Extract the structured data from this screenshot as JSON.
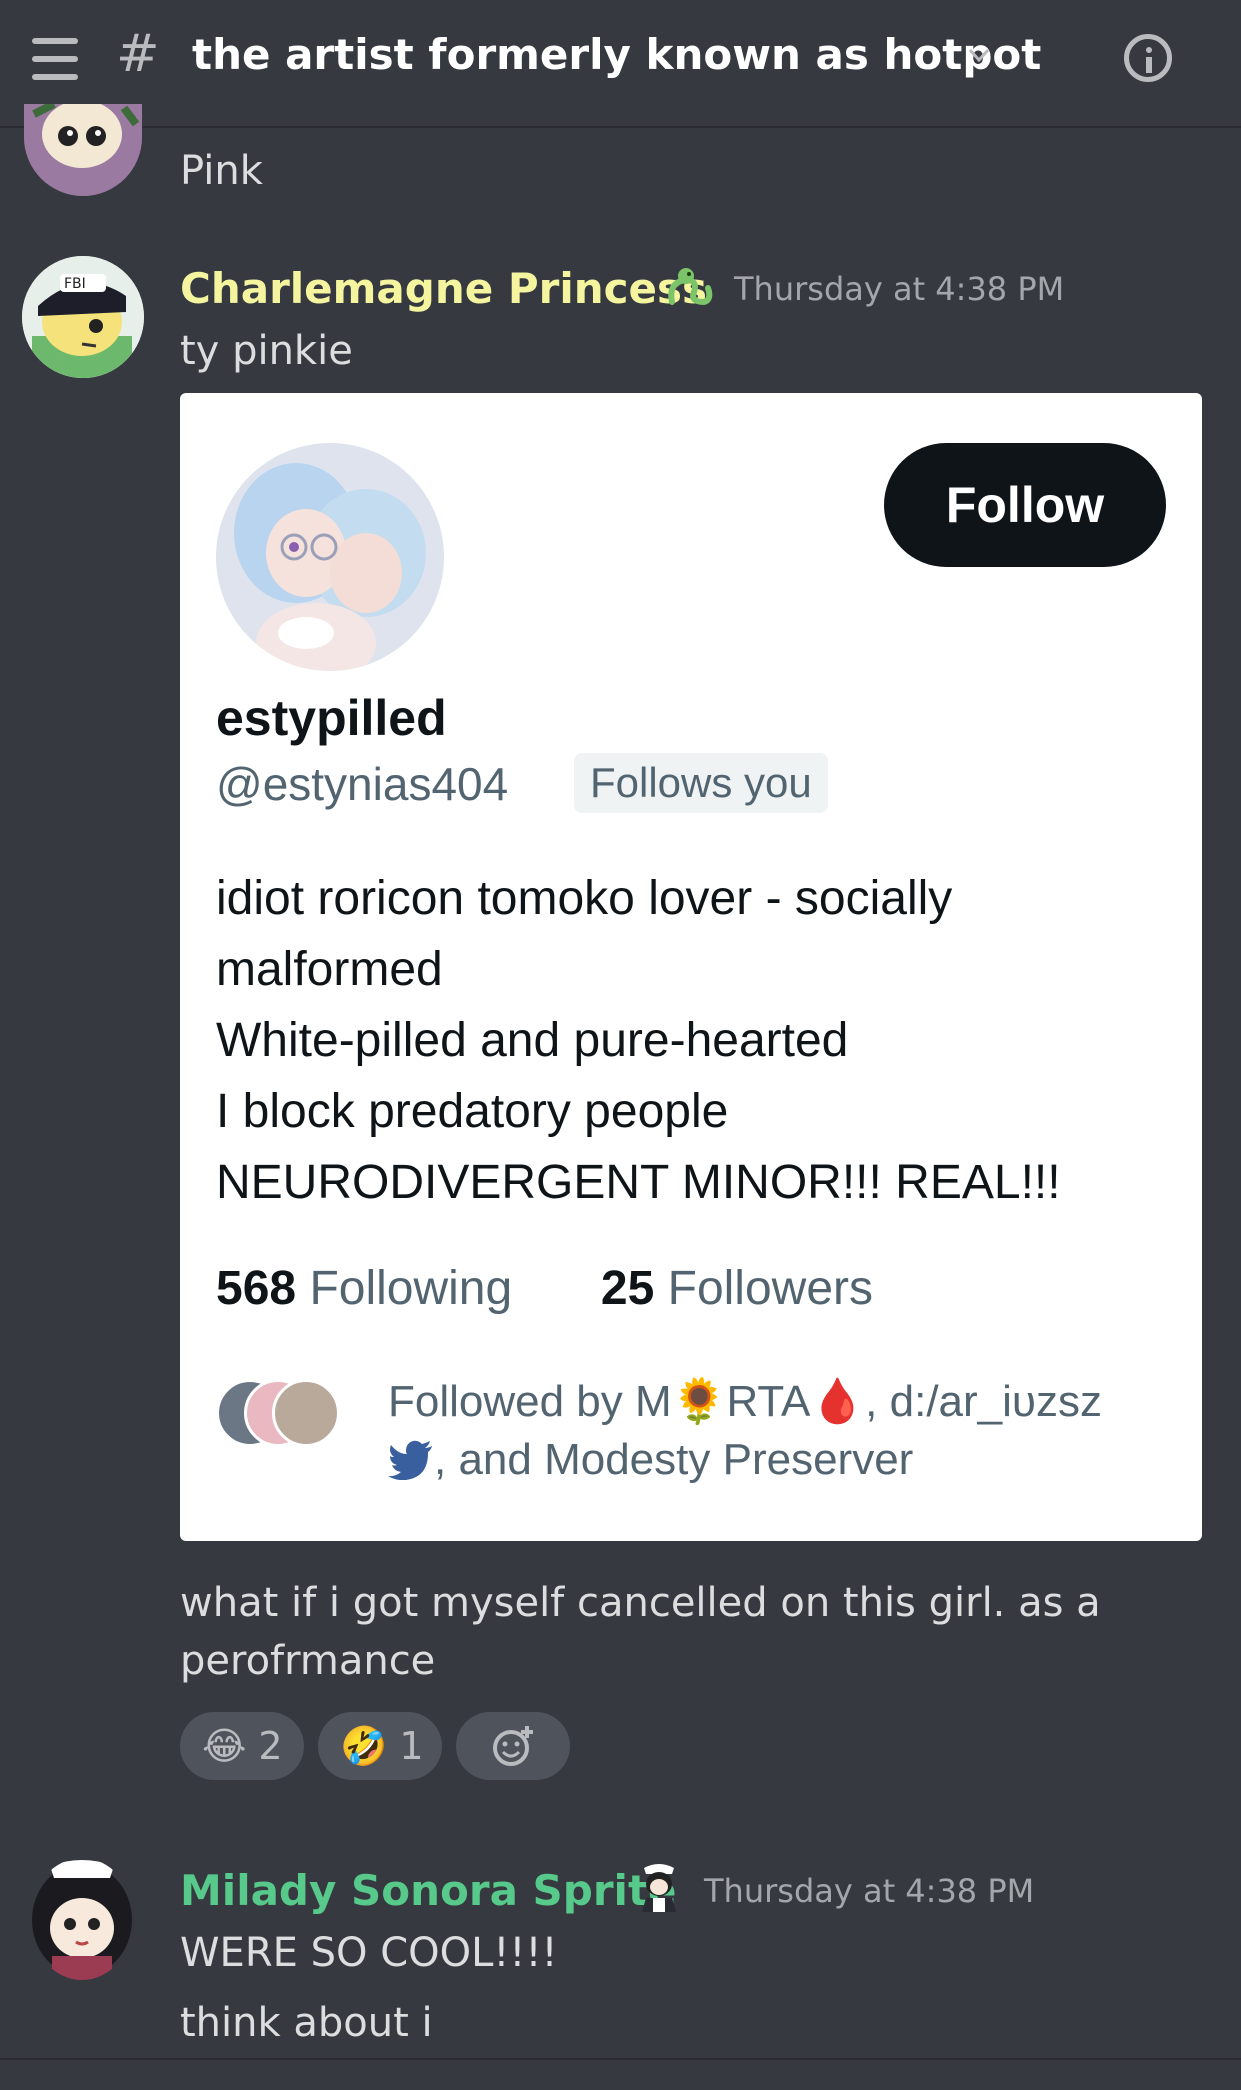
{
  "header": {
    "channel_name": "the artist formerly known as hotpot"
  },
  "messages": [
    {
      "id": "m0",
      "text": "Pink"
    },
    {
      "id": "m1",
      "author": "Charlemagne Princess",
      "author_color": "#f5f5a0",
      "timestamp": "Thursday at 4:38 PM",
      "text": "ty pinkie",
      "followup": [
        "what if i got myself cancelled on this girl. as a",
        "perofrmance"
      ]
    },
    {
      "id": "m2",
      "author": "Milady Sonora Sprite",
      "author_color": "#57c98a",
      "timestamp": "Thursday at 4:38 PM",
      "lines": [
        "WERE SO COOL!!!!",
        "think about i"
      ]
    }
  ],
  "embed": {
    "follow_label": "Follow",
    "display_name": "estypilled",
    "handle": "@estynias404",
    "follows_you_badge": "Follows you",
    "bio_lines": [
      "idiot roricon tomoko lover - socially",
      "malformed",
      "White-pilled and pure-hearted",
      "I block predatory people",
      "NEURODIVERGENT MINOR!!! REAL!!!"
    ],
    "following_count": "568",
    "following_label": "Following",
    "followers_count": "25",
    "followers_label": "Followers",
    "followed_by_line1": "Followed by M🌻RTA🩸, d:/ar_iᴜzsz",
    "followed_by_line2": ", and Modesty Preserver"
  },
  "reactions": [
    {
      "emoji": "😂",
      "count": "2"
    },
    {
      "emoji": "🤣",
      "count": "1"
    }
  ],
  "icons": [
    "hamburger-icon",
    "hash-icon",
    "chevron-down-icon",
    "info-icon",
    "add-reaction-icon",
    "twitter-bird-icon",
    "dragon-badge-icon",
    "maid-badge-icon"
  ]
}
